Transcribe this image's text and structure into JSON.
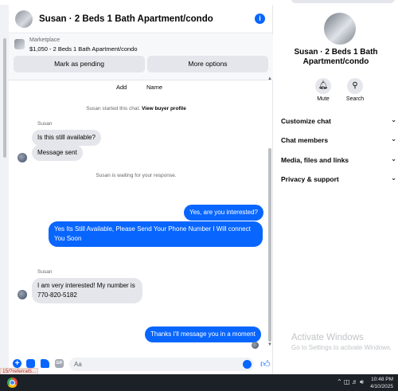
{
  "header": {
    "title": "Susan · 2 Beds 1 Bath Apartment/condo",
    "info_icon": "info-icon"
  },
  "marketplace": {
    "label": "Marketplace",
    "price_title": "$1,050 - 2 Beds 1 Bath Apartment/condo",
    "mark_pending": "Mark as pending",
    "more_options": "More options"
  },
  "meta": {
    "add": "Add",
    "name": "Name"
  },
  "system": {
    "started": "Susan started this chat.",
    "view_profile": "View buyer profile",
    "waiting": "Susan is waiting for your response."
  },
  "messages": {
    "sender_1": "Susan",
    "m1": "Is this still available?",
    "m2": "Message sent",
    "m3": "Yes, are you interested?",
    "m4": "Yes Its Still Available, Please Send Your Phone Number I Will connect You Soon",
    "sender_2": "Susan",
    "m5": "I am very interested! My number is 770-820-5182",
    "m6": "Thanks I'll message you in a moment"
  },
  "composer": {
    "placeholder": "Aa",
    "icons": [
      "plus-icon",
      "image-icon",
      "sticker-icon",
      "gif-icon",
      "emoji-icon",
      "like-icon"
    ],
    "gif": "GIF"
  },
  "details": {
    "name": "Susan · 2 Beds 1 Bath Apartment/condo",
    "mute": "Mute",
    "search": "Search",
    "menu": [
      "Customize chat",
      "Chat members",
      "Media, files and links",
      "Privacy & support"
    ]
  },
  "watermark": {
    "line1": "Activate Windows",
    "line2": "Go to Settings to activate Windows."
  },
  "status_url": "15/?referral5...",
  "taskbar": {
    "time": "10:48 PM",
    "date": "4/10/2025"
  },
  "colors": {
    "accent": "#0866ff",
    "bubble_in": "#e4e6eb",
    "taskbar": "#1c2027"
  }
}
